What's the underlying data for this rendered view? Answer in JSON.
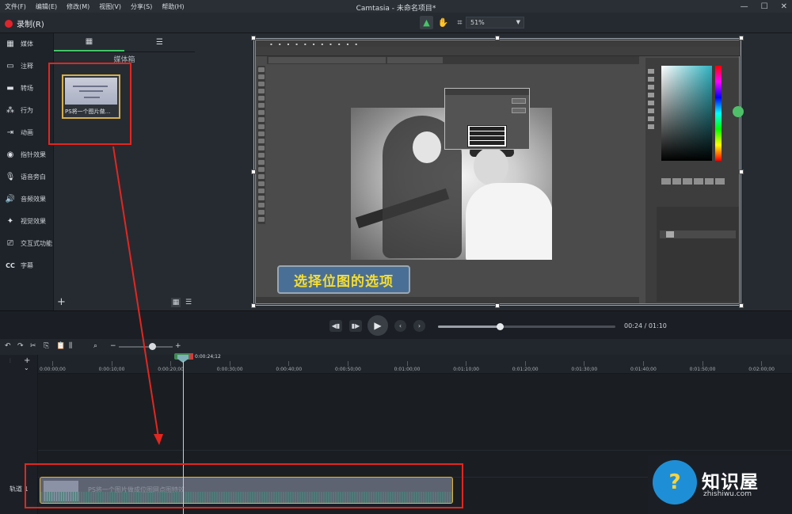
{
  "menu": [
    "文件(F)",
    "编辑(E)",
    "修改(M)",
    "视图(V)",
    "分享(S)",
    "帮助(H)"
  ],
  "app_title": "Camtasia - 未命名项目*",
  "window_controls": [
    "—",
    "☐",
    "✕"
  ],
  "toolbar": {
    "record_label": "录制(R)",
    "zoom_value": "51%"
  },
  "sidebar": [
    {
      "label": "媒体",
      "icon": "film-icon"
    },
    {
      "label": "注释",
      "icon": "annotation-icon"
    },
    {
      "label": "转场",
      "icon": "transition-icon"
    },
    {
      "label": "行为",
      "icon": "behavior-icon"
    },
    {
      "label": "动画",
      "icon": "animation-icon"
    },
    {
      "label": "指针效果",
      "icon": "cursor-icon"
    },
    {
      "label": "语音旁白",
      "icon": "microphone-icon"
    },
    {
      "label": "音频效果",
      "icon": "speaker-icon"
    },
    {
      "label": "视觉效果",
      "icon": "wand-icon"
    },
    {
      "label": "交互式功能",
      "icon": "interactive-icon"
    },
    {
      "label": "字幕",
      "icon": "captions-icon"
    }
  ],
  "media_bin": {
    "title": "媒体箱",
    "clip_label": "PS将一个图片做..."
  },
  "canvas": {
    "callout_text": "选择位图的选项"
  },
  "playback": {
    "time": "00:24 / 01:10",
    "progress": 0.35
  },
  "timeline": {
    "playhead_time": "0:00:24;12",
    "ruler": [
      "0:00:00;00",
      "0:00:10;00",
      "0:00:20;00",
      "0:00:30;00",
      "0:00:40;00",
      "0:00:50;00",
      "0:01:00;00",
      "0:01:10;00",
      "0:01:20;00",
      "0:01:30;00",
      "0:01:40;00",
      "0:01:50;00",
      "0:02:00;00"
    ],
    "track_label": "轨道 1",
    "clip_name": "PS将一个图片做成位图网点图特效",
    "zoom_level": 0.62
  },
  "logo": {
    "name": "知识屋",
    "url": "zhishiwu.com",
    "badge": "?"
  },
  "colors": {
    "accent_green": "#43c767",
    "record_red": "#e0242c",
    "highlight_red": "#e3261f",
    "clip_border": "#e2b43c"
  }
}
